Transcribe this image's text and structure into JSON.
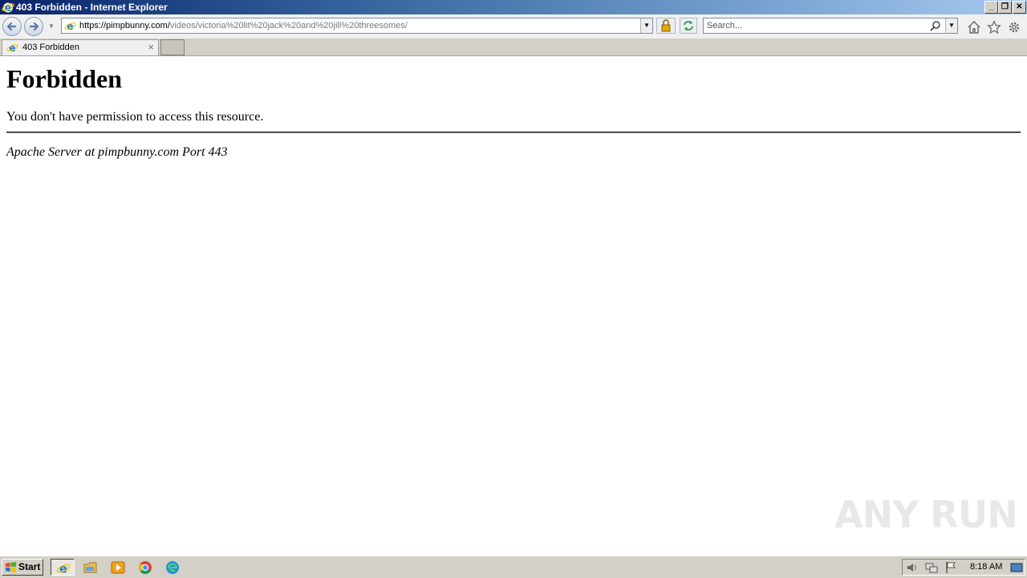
{
  "window": {
    "title": "403 Forbidden - Internet Explorer",
    "controls": {
      "minimize": "_",
      "restore": "❐",
      "close": "✕"
    }
  },
  "navbar": {
    "address": {
      "host_part": "https://pimpbunny.com/",
      "path_part": "videos/victoria%20lit%20jack%20and%20jill%20threesomes/"
    },
    "search": {
      "placeholder": "Search..."
    }
  },
  "tabs": [
    {
      "label": "403 Forbidden",
      "close": "×"
    }
  ],
  "page": {
    "heading": "Forbidden",
    "message": "You don't have permission to access this resource.",
    "server_signature": "Apache Server at pimpbunny.com Port 443"
  },
  "watermark": {
    "text": "ANY RUN"
  },
  "taskbar": {
    "start_label": "Start",
    "clock": "8:18 AM"
  }
}
